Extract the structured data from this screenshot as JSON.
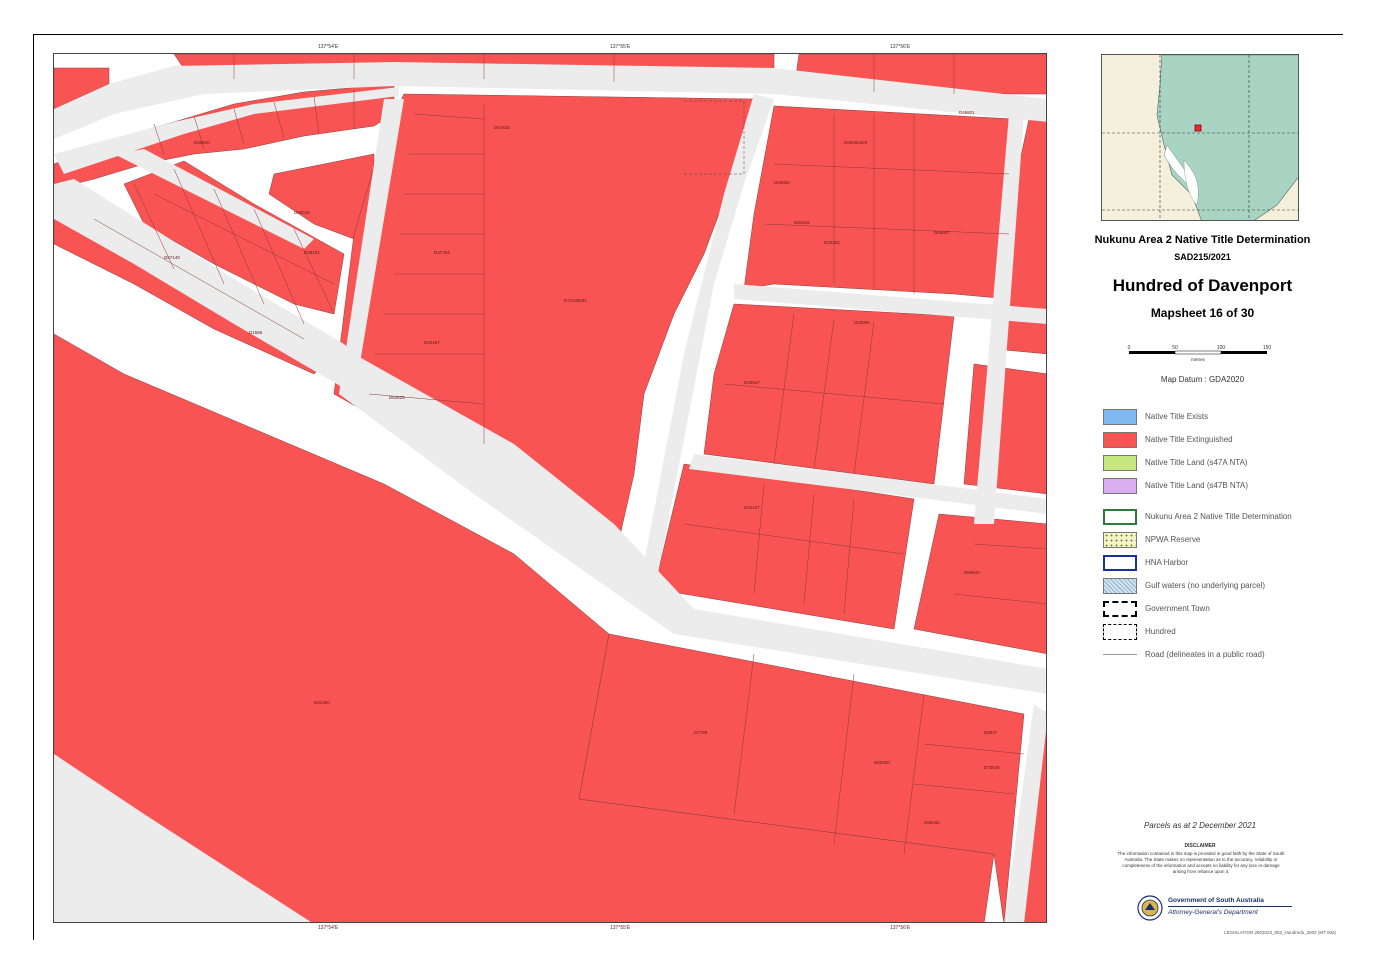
{
  "title": "Nukunu Area 2 Native Title Determination",
  "case_number": "SAD215/2021",
  "hundred": "Hundred of Davenport",
  "mapsheet": "Mapsheet 16 of 30",
  "datum": "Map Datum : GDA2020",
  "scale": {
    "ticks": [
      "0",
      "50",
      "100",
      "150"
    ],
    "unit": "metres"
  },
  "legend": [
    {
      "label": "Native Title Exists",
      "icon": "blue-fill",
      "fill": "#7fb8f0"
    },
    {
      "label": "Native Title Extinguished",
      "icon": "red-fill",
      "fill": "#f95454"
    },
    {
      "label": "Native Title Land (s47A NTA)",
      "icon": "green-fill",
      "fill": "#c7e87e"
    },
    {
      "label": "Native Title Land (s47B NTA)",
      "icon": "purple-fill",
      "fill": "#d9aef0"
    },
    {
      "label": "Nukunu Area 2 Native Title Determination",
      "icon": "green-outline",
      "fill": "#ffffff"
    },
    {
      "label": "NPWA Reserve",
      "icon": "dotted-fill",
      "fill": "#f4f4c8"
    },
    {
      "label": "HNA Harbor",
      "icon": "blue-outline",
      "fill": "#ffffff"
    },
    {
      "label": "Gulf waters (no underlying parcel)",
      "icon": "hatched-fill",
      "fill": "#cfe4f2"
    },
    {
      "label": "Government Town",
      "icon": "black-dashed-outline",
      "fill": "#ffffff"
    },
    {
      "label": "Hundred",
      "icon": "dashed-outline",
      "fill": "#ffffff"
    },
    {
      "label": "Road (delineates in a public road)",
      "icon": "road-line",
      "fill": "#ffffff"
    }
  ],
  "parcels_date": "Parcels as at 2 December 2021",
  "disclaimer_title": "DISCLAIMER",
  "disclaimer_text": "The information contained in this map is provided in good faith by the State of South Australia. The State makes no representation as to the accuracy, reliability or completeness of the information and accepts no liability for any loss or damage arising from reliance upon it.",
  "government": {
    "line1": "Government of South Australia",
    "line2": "Attorney-General's Department"
  },
  "footer_code": "LEGISLATION 2602023_802_Hundreds_2602 (MT 00a)",
  "colors": {
    "extinguished": "#f95454",
    "road": "#ececec",
    "parcel_line": "#8a3a3a"
  },
  "parcel_labels": [
    {
      "id": "p1",
      "text": "D71188631"
    },
    {
      "id": "p2",
      "text": "D66066320"
    },
    {
      "id": "p3",
      "text": "D26252"
    },
    {
      "id": "p4",
      "text": "D49347"
    },
    {
      "id": "p5",
      "text": "D52000"
    },
    {
      "id": "p6",
      "text": "D28547"
    },
    {
      "id": "p7",
      "text": "D37764"
    },
    {
      "id": "p8",
      "text": "D25457"
    },
    {
      "id": "p9",
      "text": "D31427"
    },
    {
      "id": "p10",
      "text": "D84543"
    },
    {
      "id": "p11",
      "text": "D61460"
    },
    {
      "id": "p12",
      "text": "D7786"
    },
    {
      "id": "p13",
      "text": "D62000"
    },
    {
      "id": "p14",
      "text": "D85342"
    },
    {
      "id": "p15",
      "text": "D67434"
    },
    {
      "id": "p16",
      "text": "D66353"
    },
    {
      "id": "p17",
      "text": "D46821"
    },
    {
      "id": "p18",
      "text": "D81543"
    },
    {
      "id": "p19",
      "text": "D1586"
    },
    {
      "id": "p20",
      "text": "D59243"
    },
    {
      "id": "p21",
      "text": "D57140"
    },
    {
      "id": "p22",
      "text": "D50620"
    },
    {
      "id": "p23",
      "text": "D38231"
    },
    {
      "id": "p24",
      "text": "D63525"
    },
    {
      "id": "p25",
      "text": "D5847"
    },
    {
      "id": "p26",
      "text": "D75548"
    }
  ]
}
